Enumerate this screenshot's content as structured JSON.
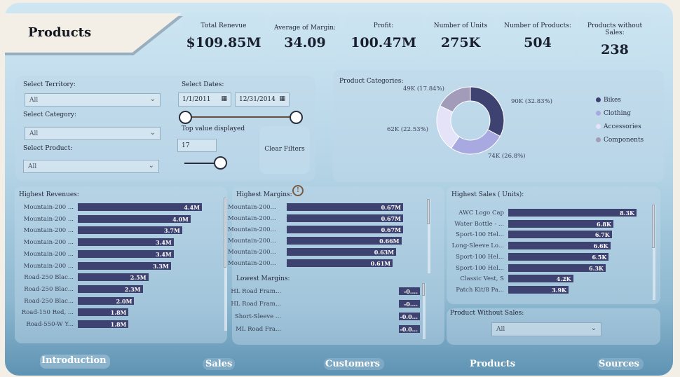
{
  "page": {
    "title": "Products"
  },
  "kpis": [
    {
      "label": "Total Renevue",
      "value": "$109.85M"
    },
    {
      "label": "Average of Margin:",
      "value": "34.09"
    },
    {
      "label": "Profit:",
      "value": "100.47M"
    },
    {
      "label": "Number of Units",
      "value": "275K"
    },
    {
      "label": "Number of Products:",
      "value": "504"
    },
    {
      "label": "Products without Sales:",
      "value": "238"
    }
  ],
  "filters": {
    "territory_label": "Select Territory:",
    "territory_value": "All",
    "category_label": "Select Category:",
    "category_value": "All",
    "product_label": "Select Product:",
    "product_value": "All",
    "dates_label": "Select Dates:",
    "date_start": "1/1/2011",
    "date_end": "12/31/2014",
    "top_label": "Top value displayed",
    "top_value": "17",
    "clear_label": "Clear Filters"
  },
  "product_categories": {
    "title": "Product Categories:",
    "legend": [
      "Bikes",
      "Clothing",
      "Accessories",
      "Components"
    ],
    "colors": [
      "#3e4270",
      "#a8a9e0",
      "#e4e3f8",
      "#a29bb9"
    ],
    "slice_labels": [
      "90K (32.83%)",
      "74K (26.8%)",
      "62K (22.53%)",
      "49K (17.84%)"
    ]
  },
  "highest_revenues": {
    "title": "Highest Revenues:",
    "rows": [
      {
        "label": "Mountain-200 ...",
        "value": "4.4M"
      },
      {
        "label": "Mountain-200 ...",
        "value": "4.0M"
      },
      {
        "label": "Mountain-200 ...",
        "value": "3.7M"
      },
      {
        "label": "Mountain-200 ...",
        "value": "3.4M"
      },
      {
        "label": "Mountain-200 ...",
        "value": "3.4M"
      },
      {
        "label": "Mountain-200 ...",
        "value": "3.3M"
      },
      {
        "label": "Road-250 Blac...",
        "value": "2.5M"
      },
      {
        "label": "Road-250 Blac...",
        "value": "2.3M"
      },
      {
        "label": "Road-250 Blac...",
        "value": "2.0M"
      },
      {
        "label": "Road-150 Red, ...",
        "value": "1.8M"
      },
      {
        "label": "Road-550-W Y...",
        "value": "1.8M"
      }
    ]
  },
  "highest_margins": {
    "title": "Highest Margins:",
    "rows": [
      {
        "label": "Mountain-200...",
        "value": "0.67M"
      },
      {
        "label": "Mountain-200...",
        "value": "0.67M"
      },
      {
        "label": "Mountain-200...",
        "value": "0.67M"
      },
      {
        "label": "Mountain-200...",
        "value": "0.66M"
      },
      {
        "label": "Mountain-200...",
        "value": "0.63M"
      },
      {
        "label": "Mountain-200...",
        "value": "0.61M"
      }
    ]
  },
  "lowest_margins": {
    "title": "Lowest Margins:",
    "rows": [
      {
        "label": "HL Road Fram...",
        "value": "-0...."
      },
      {
        "label": "HL Road Fram...",
        "value": "-0...."
      },
      {
        "label": "Short-Sleeve ...",
        "value": "-0.0..."
      },
      {
        "label": "ML Road Fra...",
        "value": "-0.0..."
      }
    ]
  },
  "highest_sales": {
    "title": "Highest Sales ( Units):",
    "rows": [
      {
        "label": "AWC Logo Cap",
        "value": "8.3K"
      },
      {
        "label": "Water Bottle - ...",
        "value": "6.8K"
      },
      {
        "label": "Sport-100 Hel...",
        "value": "6.7K"
      },
      {
        "label": "Long-Sleeve Lo...",
        "value": "6.6K"
      },
      {
        "label": "Sport-100 Hel...",
        "value": "6.5K"
      },
      {
        "label": "Sport-100 Hel...",
        "value": "6.3K"
      },
      {
        "label": "Classic Vest, S",
        "value": "4.2K"
      },
      {
        "label": "Patch Kit/8 Pa...",
        "value": "3.9K"
      }
    ]
  },
  "products_without_sales": {
    "title": "Product Without Sales:",
    "value": "All"
  },
  "nav": [
    "Introduction",
    "Sales",
    "Customers",
    "Products",
    "Sources"
  ],
  "chart_data": [
    {
      "type": "pie",
      "title": "Product Categories:",
      "categories": [
        "Bikes",
        "Clothing",
        "Accessories",
        "Components"
      ],
      "values": [
        90,
        74,
        62,
        49
      ],
      "percentages": [
        32.83,
        26.8,
        22.53,
        17.84
      ]
    },
    {
      "type": "bar",
      "title": "Highest Revenues:",
      "categories": [
        "Mountain-200 ...",
        "Mountain-200 ...",
        "Mountain-200 ...",
        "Mountain-200 ...",
        "Mountain-200 ...",
        "Mountain-200 ...",
        "Road-250 Blac...",
        "Road-250 Blac...",
        "Road-250 Blac...",
        "Road-150 Red, ...",
        "Road-550-W Y..."
      ],
      "values": [
        4.4,
        4.0,
        3.7,
        3.4,
        3.4,
        3.3,
        2.5,
        2.3,
        2.0,
        1.8,
        1.8
      ]
    },
    {
      "type": "bar",
      "title": "Highest Margins:",
      "categories": [
        "Mountain-200...",
        "Mountain-200...",
        "Mountain-200...",
        "Mountain-200...",
        "Mountain-200...",
        "Mountain-200..."
      ],
      "values": [
        0.67,
        0.67,
        0.67,
        0.66,
        0.63,
        0.61
      ]
    },
    {
      "type": "bar",
      "title": "Highest Sales ( Units):",
      "categories": [
        "AWC Logo Cap",
        "Water Bottle - ...",
        "Sport-100 Hel...",
        "Long-Sleeve Lo...",
        "Sport-100 Hel...",
        "Sport-100 Hel...",
        "Classic Vest, S",
        "Patch Kit/8 Pa..."
      ],
      "values": [
        8.3,
        6.8,
        6.7,
        6.6,
        6.5,
        6.3,
        4.2,
        3.9
      ]
    }
  ]
}
